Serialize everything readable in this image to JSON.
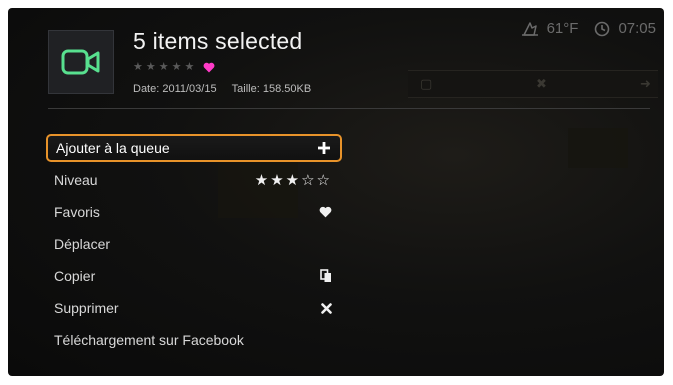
{
  "header": {
    "title": "5 items selected",
    "rating_stars": [
      "★",
      "★",
      "★",
      "★",
      "★"
    ],
    "date": "Date: 2011/03/15",
    "size": "Taille: 158.50KB",
    "favorite_color": "#ff3bc8",
    "thumb_icon_color": "#58e08f"
  },
  "status": {
    "temperature": "61°F",
    "time": "07:05"
  },
  "menu": {
    "items": [
      {
        "label": "Ajouter à la queue",
        "icon": "plus-icon",
        "value": "+"
      },
      {
        "label": "Niveau",
        "value": "★★★☆☆",
        "rating": 3,
        "max": 5
      },
      {
        "label": "Favoris",
        "icon": "heart-icon"
      },
      {
        "label": "Déplacer"
      },
      {
        "label": "Copier",
        "icon": "copy-icon"
      },
      {
        "label": "Supprimer",
        "icon": "delete-icon",
        "value": "✖"
      },
      {
        "label": "Téléchargement sur Facebook"
      }
    ]
  },
  "colors": {
    "selection_border": "#e8932a",
    "background": "#0a0a0a"
  }
}
